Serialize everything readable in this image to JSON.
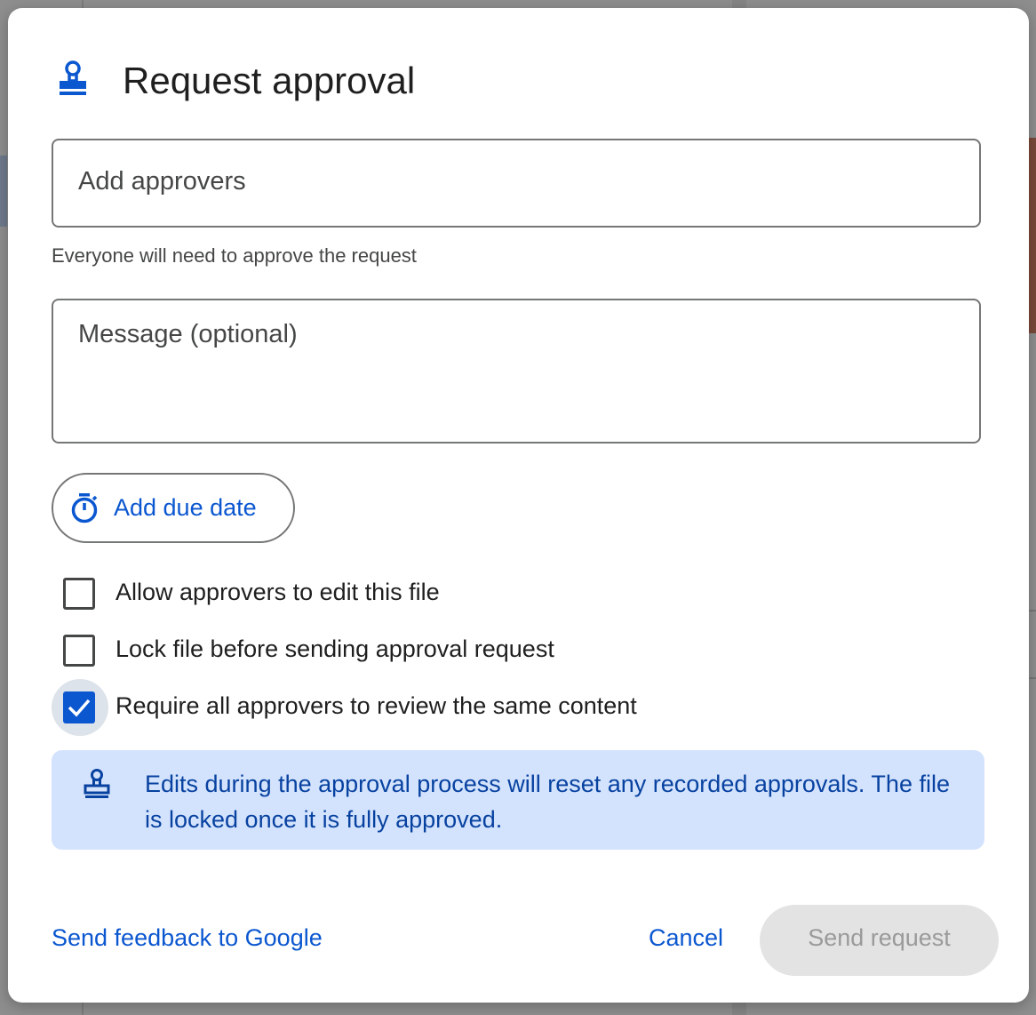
{
  "dialog": {
    "title": "Request approval",
    "title_icon": "approval-stamp-icon",
    "approvers_field": {
      "placeholder": "Add approvers",
      "value": ""
    },
    "approvers_helper": "Everyone will need to approve the request",
    "message_field": {
      "placeholder": "Message (optional)",
      "value": ""
    },
    "due_date_button": {
      "label": "Add due date",
      "icon": "timer-icon"
    },
    "options": [
      {
        "label": "Allow approvers to edit this file",
        "checked": false
      },
      {
        "label": "Lock file before sending approval request",
        "checked": false
      },
      {
        "label": "Require all approvers to review the same content",
        "checked": true
      }
    ],
    "info": {
      "icon": "approval-stamp-icon",
      "text": "Edits during the approval process will reset any recorded approvals. The file is locked once it is fully approved."
    },
    "footer": {
      "feedback_link": "Send feedback to Google",
      "cancel_label": "Cancel",
      "send_label": "Send request",
      "send_disabled": true
    }
  },
  "colors": {
    "accent": "#0b57d0",
    "info_background": "#d3e3fd",
    "info_text": "#0842a0",
    "disabled_button": "#e3e3e3"
  }
}
